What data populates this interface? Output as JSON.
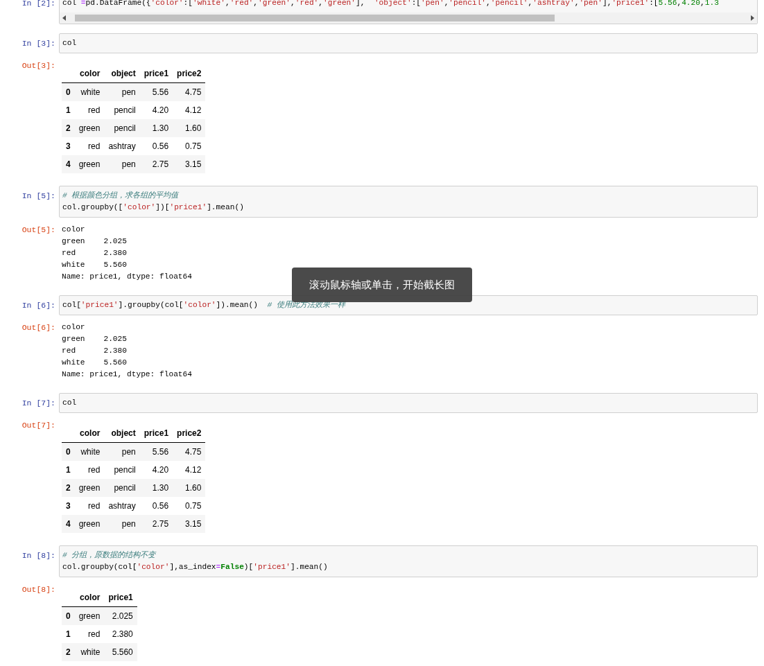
{
  "cells": [
    {
      "prompt": "In [2]:",
      "horizontal_scrollbar": true,
      "lines": [
        [
          {
            "kind": "plain",
            "text": "col "
          },
          {
            "kind": "operator",
            "text": "="
          },
          {
            "kind": "plain",
            "text": "pd.DataFrame({"
          },
          {
            "kind": "string",
            "text": "'color'"
          },
          {
            "kind": "plain",
            "text": ":["
          },
          {
            "kind": "string",
            "text": "'white'"
          },
          {
            "kind": "plain",
            "text": ","
          },
          {
            "kind": "string",
            "text": "'red'"
          },
          {
            "kind": "plain",
            "text": ","
          },
          {
            "kind": "string",
            "text": "'green'"
          },
          {
            "kind": "plain",
            "text": ","
          },
          {
            "kind": "string",
            "text": "'red'"
          },
          {
            "kind": "plain",
            "text": ","
          },
          {
            "kind": "string",
            "text": "'green'"
          },
          {
            "kind": "plain",
            "text": "],  "
          },
          {
            "kind": "string",
            "text": "'object'"
          },
          {
            "kind": "plain",
            "text": ":["
          },
          {
            "kind": "string",
            "text": "'pen'"
          },
          {
            "kind": "plain",
            "text": ","
          },
          {
            "kind": "string",
            "text": "'pencil'"
          },
          {
            "kind": "plain",
            "text": ","
          },
          {
            "kind": "string",
            "text": "'pencil'"
          },
          {
            "kind": "plain",
            "text": ","
          },
          {
            "kind": "string",
            "text": "'ashtray'"
          },
          {
            "kind": "plain",
            "text": ","
          },
          {
            "kind": "string",
            "text": "'pen'"
          },
          {
            "kind": "plain",
            "text": "],"
          },
          {
            "kind": "string",
            "text": "'price1'"
          },
          {
            "kind": "plain",
            "text": ":["
          },
          {
            "kind": "number",
            "text": "5.56"
          },
          {
            "kind": "plain",
            "text": ","
          },
          {
            "kind": "number",
            "text": "4.20"
          },
          {
            "kind": "plain",
            "text": ","
          },
          {
            "kind": "number",
            "text": "1.3"
          }
        ]
      ]
    },
    {
      "prompt": "In [3]:",
      "lines": [
        [
          {
            "kind": "plain",
            "text": "col"
          }
        ]
      ],
      "output": {
        "prompt": "Out[3]:",
        "kind": "table",
        "columns": [
          "",
          "color",
          "object",
          "price1",
          "price2"
        ],
        "rows": [
          [
            "0",
            "white",
            "pen",
            "5.56",
            "4.75"
          ],
          [
            "1",
            "red",
            "pencil",
            "4.20",
            "4.12"
          ],
          [
            "2",
            "green",
            "pencil",
            "1.30",
            "1.60"
          ],
          [
            "3",
            "red",
            "ashtray",
            "0.56",
            "0.75"
          ],
          [
            "4",
            "green",
            "pen",
            "2.75",
            "3.15"
          ]
        ]
      }
    },
    {
      "prompt": "In [5]:",
      "lines": [
        [
          {
            "kind": "comment",
            "text": "# 根据颜色分组，求各组的平均值"
          }
        ],
        [
          {
            "kind": "plain",
            "text": "col.groupby(["
          },
          {
            "kind": "string",
            "text": "'color'"
          },
          {
            "kind": "plain",
            "text": "])["
          },
          {
            "kind": "string",
            "text": "'price1'"
          },
          {
            "kind": "plain",
            "text": "].mean()"
          }
        ]
      ],
      "output": {
        "prompt": "Out[5]:",
        "kind": "text",
        "lines": [
          "color",
          "green    2.025",
          "red      2.380",
          "white    5.560",
          "Name: price1, dtype: float64"
        ]
      }
    },
    {
      "prompt": "In [6]:",
      "lines": [
        [
          {
            "kind": "plain",
            "text": "col["
          },
          {
            "kind": "string",
            "text": "'price1'"
          },
          {
            "kind": "plain",
            "text": "].groupby(col["
          },
          {
            "kind": "string",
            "text": "'color'"
          },
          {
            "kind": "plain",
            "text": "]).mean()  "
          },
          {
            "kind": "comment",
            "text": "# 使用此方法效果一样"
          }
        ]
      ],
      "output": {
        "prompt": "Out[6]:",
        "kind": "text",
        "lines": [
          "color",
          "green    2.025",
          "red      2.380",
          "white    5.560",
          "Name: price1, dtype: float64"
        ]
      }
    },
    {
      "prompt": "In [7]:",
      "lines": [
        [
          {
            "kind": "plain",
            "text": "col"
          }
        ]
      ],
      "output": {
        "prompt": "Out[7]:",
        "kind": "table",
        "columns": [
          "",
          "color",
          "object",
          "price1",
          "price2"
        ],
        "rows": [
          [
            "0",
            "white",
            "pen",
            "5.56",
            "4.75"
          ],
          [
            "1",
            "red",
            "pencil",
            "4.20",
            "4.12"
          ],
          [
            "2",
            "green",
            "pencil",
            "1.30",
            "1.60"
          ],
          [
            "3",
            "red",
            "ashtray",
            "0.56",
            "0.75"
          ],
          [
            "4",
            "green",
            "pen",
            "2.75",
            "3.15"
          ]
        ]
      }
    },
    {
      "prompt": "In [8]:",
      "lines": [
        [
          {
            "kind": "comment",
            "text": "# 分组，原数据的结构不变"
          }
        ],
        [
          {
            "kind": "plain",
            "text": "col.groupby(col["
          },
          {
            "kind": "string",
            "text": "'color'"
          },
          {
            "kind": "plain",
            "text": "],as_index"
          },
          {
            "kind": "operator",
            "text": "="
          },
          {
            "kind": "keyword",
            "text": "False"
          },
          {
            "kind": "plain",
            "text": ")["
          },
          {
            "kind": "string",
            "text": "'price1'"
          },
          {
            "kind": "plain",
            "text": "].mean()"
          }
        ]
      ],
      "output": {
        "prompt": "Out[8]:",
        "kind": "table",
        "columns": [
          "",
          "color",
          "price1"
        ],
        "rows": [
          [
            "0",
            "green",
            "2.025"
          ],
          [
            "1",
            "red",
            "2.380"
          ],
          [
            "2",
            "white",
            "5.560"
          ]
        ]
      }
    }
  ],
  "toast": {
    "text": "滚动鼠标轴或单击，开始截长图"
  }
}
